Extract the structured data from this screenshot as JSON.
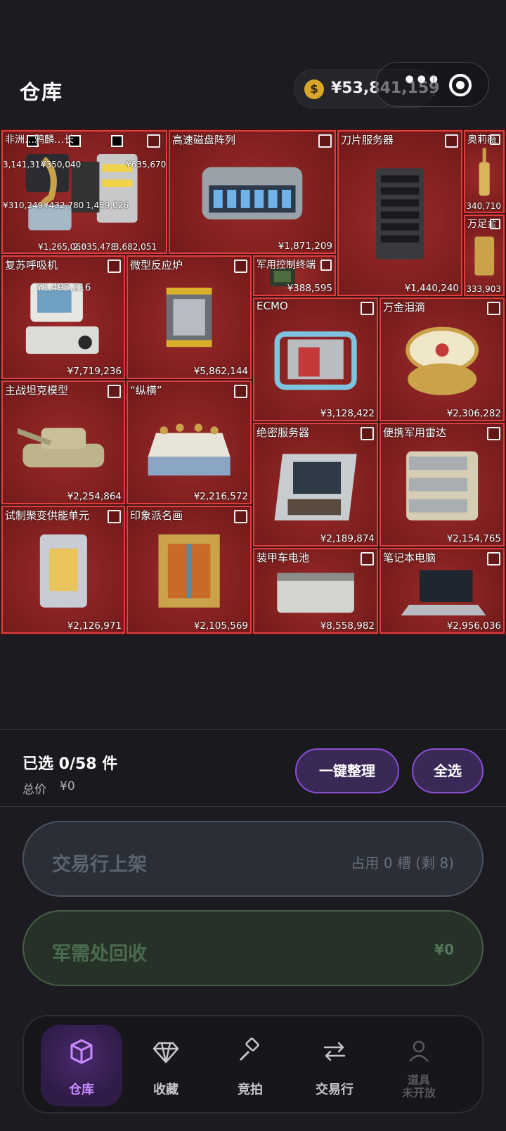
{
  "header": {
    "title": "仓库",
    "balance": "¥53,841,159",
    "coin_symbol": "$",
    "more_icon": "more-dots-icon",
    "target_icon": "target-icon"
  },
  "items": [
    {
      "id": "hdd",
      "name": "高速磁盘阵列",
      "price": "¥1,871,209"
    },
    {
      "id": "blade",
      "name": "刀片服务器",
      "price": "¥1,440,240"
    },
    {
      "id": "olive",
      "name": "奥莉薇",
      "price": "¥340,710"
    },
    {
      "id": "gold",
      "name": "万足金",
      "price": "¥333,903"
    },
    {
      "id": "resp",
      "name": "复苏呼吸机",
      "price": "¥7,719,236"
    },
    {
      "id": "reactor",
      "name": "微型反应炉",
      "price": "¥5,862,144"
    },
    {
      "id": "mil",
      "name": "军用控制终端",
      "price": "¥388,595"
    },
    {
      "id": "ecmo",
      "name": "ECMO",
      "price": "¥3,128,422"
    },
    {
      "id": "egg",
      "name": "万金泪滴",
      "price": "¥2,306,282"
    },
    {
      "id": "tank",
      "name": "主战坦克模型",
      "price": "¥2,254,864"
    },
    {
      "id": "chess",
      "name": "“纵横”",
      "price": "¥2,216,572"
    },
    {
      "id": "secret",
      "name": "绝密服务器",
      "price": "¥2,189,874"
    },
    {
      "id": "radar",
      "name": "便携军用雷达",
      "price": "¥2,154,765"
    },
    {
      "id": "fusion",
      "name": "试制聚变供能单元",
      "price": "¥2,126,971"
    },
    {
      "id": "paint",
      "name": "印象派名画",
      "price": "¥2,105,569"
    },
    {
      "id": "battery",
      "name": "装甲车电池",
      "price": "¥8,558,982"
    },
    {
      "id": "laptop",
      "name": "笔记本电脑",
      "price": "¥2,956,036"
    }
  ],
  "overlap_cell": {
    "label_top": "非洲…鸦麟…长",
    "labels": [
      "3,141,314",
      "¥350,040",
      "¥635,670",
      "¥310,249",
      "¥432,780",
      "1,459,026",
      "¥1,265,066",
      "2,035,478",
      "3,682,051"
    ],
    "price_partial": "¥1,495,216"
  },
  "selection": {
    "count_label": "已选 0/58 件",
    "total_label": "总价",
    "total_value": "¥0",
    "organize_button": "一键整理",
    "select_all_button": "全选"
  },
  "actions": {
    "market": {
      "label": "交易行上架",
      "status": "占用 0 槽 (剩 8)"
    },
    "recycle": {
      "label": "军需处回收",
      "value": "¥0"
    }
  },
  "nav": [
    {
      "label": "仓库",
      "icon": "box-icon",
      "active": true
    },
    {
      "label": "收藏",
      "icon": "diamond-icon"
    },
    {
      "label": "竞拍",
      "icon": "gavel-icon"
    },
    {
      "label": "交易行",
      "icon": "exchange-icon"
    },
    {
      "label": "道具",
      "sublabel": "未开放",
      "icon": "person-icon",
      "disabled": true
    }
  ],
  "colors": {
    "accent": "#8b4fd6",
    "item_border": "#e13e3e",
    "coin": "#d8a629"
  }
}
